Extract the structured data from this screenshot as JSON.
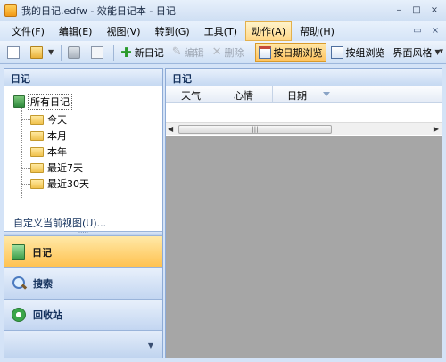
{
  "window": {
    "title": "我的日记.edfw - 效能日记本 - 日记",
    "controls": {
      "minimize": "–",
      "maximize": "□",
      "close": "×"
    }
  },
  "menu": {
    "items": [
      {
        "label": "文件(F)"
      },
      {
        "label": "编辑(E)"
      },
      {
        "label": "视图(V)"
      },
      {
        "label": "转到(G)"
      },
      {
        "label": "工具(T)"
      },
      {
        "label": "动作(A)"
      },
      {
        "label": "帮助(H)"
      }
    ],
    "active_index": 5
  },
  "toolbar": {
    "new_diary": "新日记",
    "edit": "编辑",
    "delete": "删除",
    "browse_by_date": "按日期浏览",
    "browse_by_group": "按组浏览",
    "ui_style": "界面风格"
  },
  "left_pane": {
    "title": "日记",
    "tree": {
      "root": "所有日记",
      "children": [
        "今天",
        "本月",
        "本年",
        "最近7天",
        "最近30天"
      ]
    },
    "customize_view": "自定义当前视图(U)...",
    "nav": {
      "diary": "日记",
      "search": "搜索",
      "recycle": "回收站"
    }
  },
  "right_pane": {
    "title": "日记",
    "columns": [
      "天气",
      "心情",
      "日期"
    ],
    "scroll_grip": "|||"
  },
  "icons": {
    "app": "diary-app-icon",
    "new": "new-document-icon",
    "open": "open-folder-icon",
    "print": "printer-icon",
    "preview": "print-preview-icon",
    "add": "plus-icon",
    "edit": "pencil-icon",
    "delete": "x-icon",
    "calendar": "calendar-icon",
    "group": "group-icon"
  },
  "colors": {
    "accent_orange": "#ffc14e",
    "pane_border": "#8eabd6",
    "content_gray": "#a6a6a6"
  }
}
